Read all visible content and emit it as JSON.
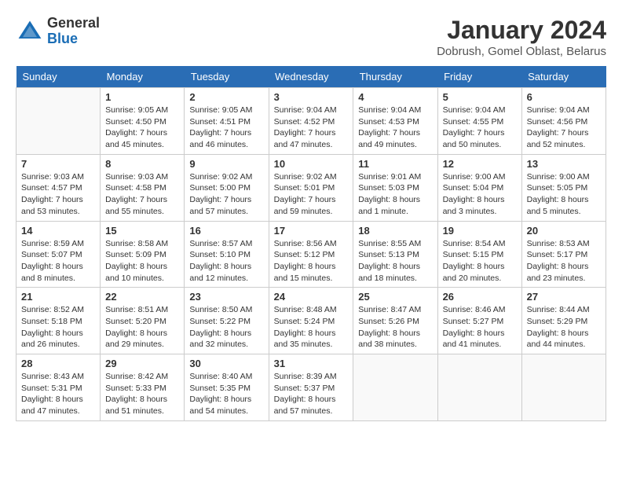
{
  "header": {
    "logo_general": "General",
    "logo_blue": "Blue",
    "month_title": "January 2024",
    "location": "Dobrush, Gomel Oblast, Belarus"
  },
  "days_of_week": [
    "Sunday",
    "Monday",
    "Tuesday",
    "Wednesday",
    "Thursday",
    "Friday",
    "Saturday"
  ],
  "weeks": [
    [
      {
        "day": "",
        "info": ""
      },
      {
        "day": "1",
        "info": "Sunrise: 9:05 AM\nSunset: 4:50 PM\nDaylight: 7 hours\nand 45 minutes."
      },
      {
        "day": "2",
        "info": "Sunrise: 9:05 AM\nSunset: 4:51 PM\nDaylight: 7 hours\nand 46 minutes."
      },
      {
        "day": "3",
        "info": "Sunrise: 9:04 AM\nSunset: 4:52 PM\nDaylight: 7 hours\nand 47 minutes."
      },
      {
        "day": "4",
        "info": "Sunrise: 9:04 AM\nSunset: 4:53 PM\nDaylight: 7 hours\nand 49 minutes."
      },
      {
        "day": "5",
        "info": "Sunrise: 9:04 AM\nSunset: 4:55 PM\nDaylight: 7 hours\nand 50 minutes."
      },
      {
        "day": "6",
        "info": "Sunrise: 9:04 AM\nSunset: 4:56 PM\nDaylight: 7 hours\nand 52 minutes."
      }
    ],
    [
      {
        "day": "7",
        "info": "Sunrise: 9:03 AM\nSunset: 4:57 PM\nDaylight: 7 hours\nand 53 minutes."
      },
      {
        "day": "8",
        "info": "Sunrise: 9:03 AM\nSunset: 4:58 PM\nDaylight: 7 hours\nand 55 minutes."
      },
      {
        "day": "9",
        "info": "Sunrise: 9:02 AM\nSunset: 5:00 PM\nDaylight: 7 hours\nand 57 minutes."
      },
      {
        "day": "10",
        "info": "Sunrise: 9:02 AM\nSunset: 5:01 PM\nDaylight: 7 hours\nand 59 minutes."
      },
      {
        "day": "11",
        "info": "Sunrise: 9:01 AM\nSunset: 5:03 PM\nDaylight: 8 hours\nand 1 minute."
      },
      {
        "day": "12",
        "info": "Sunrise: 9:00 AM\nSunset: 5:04 PM\nDaylight: 8 hours\nand 3 minutes."
      },
      {
        "day": "13",
        "info": "Sunrise: 9:00 AM\nSunset: 5:05 PM\nDaylight: 8 hours\nand 5 minutes."
      }
    ],
    [
      {
        "day": "14",
        "info": "Sunrise: 8:59 AM\nSunset: 5:07 PM\nDaylight: 8 hours\nand 8 minutes."
      },
      {
        "day": "15",
        "info": "Sunrise: 8:58 AM\nSunset: 5:09 PM\nDaylight: 8 hours\nand 10 minutes."
      },
      {
        "day": "16",
        "info": "Sunrise: 8:57 AM\nSunset: 5:10 PM\nDaylight: 8 hours\nand 12 minutes."
      },
      {
        "day": "17",
        "info": "Sunrise: 8:56 AM\nSunset: 5:12 PM\nDaylight: 8 hours\nand 15 minutes."
      },
      {
        "day": "18",
        "info": "Sunrise: 8:55 AM\nSunset: 5:13 PM\nDaylight: 8 hours\nand 18 minutes."
      },
      {
        "day": "19",
        "info": "Sunrise: 8:54 AM\nSunset: 5:15 PM\nDaylight: 8 hours\nand 20 minutes."
      },
      {
        "day": "20",
        "info": "Sunrise: 8:53 AM\nSunset: 5:17 PM\nDaylight: 8 hours\nand 23 minutes."
      }
    ],
    [
      {
        "day": "21",
        "info": "Sunrise: 8:52 AM\nSunset: 5:18 PM\nDaylight: 8 hours\nand 26 minutes."
      },
      {
        "day": "22",
        "info": "Sunrise: 8:51 AM\nSunset: 5:20 PM\nDaylight: 8 hours\nand 29 minutes."
      },
      {
        "day": "23",
        "info": "Sunrise: 8:50 AM\nSunset: 5:22 PM\nDaylight: 8 hours\nand 32 minutes."
      },
      {
        "day": "24",
        "info": "Sunrise: 8:48 AM\nSunset: 5:24 PM\nDaylight: 8 hours\nand 35 minutes."
      },
      {
        "day": "25",
        "info": "Sunrise: 8:47 AM\nSunset: 5:26 PM\nDaylight: 8 hours\nand 38 minutes."
      },
      {
        "day": "26",
        "info": "Sunrise: 8:46 AM\nSunset: 5:27 PM\nDaylight: 8 hours\nand 41 minutes."
      },
      {
        "day": "27",
        "info": "Sunrise: 8:44 AM\nSunset: 5:29 PM\nDaylight: 8 hours\nand 44 minutes."
      }
    ],
    [
      {
        "day": "28",
        "info": "Sunrise: 8:43 AM\nSunset: 5:31 PM\nDaylight: 8 hours\nand 47 minutes."
      },
      {
        "day": "29",
        "info": "Sunrise: 8:42 AM\nSunset: 5:33 PM\nDaylight: 8 hours\nand 51 minutes."
      },
      {
        "day": "30",
        "info": "Sunrise: 8:40 AM\nSunset: 5:35 PM\nDaylight: 8 hours\nand 54 minutes."
      },
      {
        "day": "31",
        "info": "Sunrise: 8:39 AM\nSunset: 5:37 PM\nDaylight: 8 hours\nand 57 minutes."
      },
      {
        "day": "",
        "info": ""
      },
      {
        "day": "",
        "info": ""
      },
      {
        "day": "",
        "info": ""
      }
    ]
  ]
}
